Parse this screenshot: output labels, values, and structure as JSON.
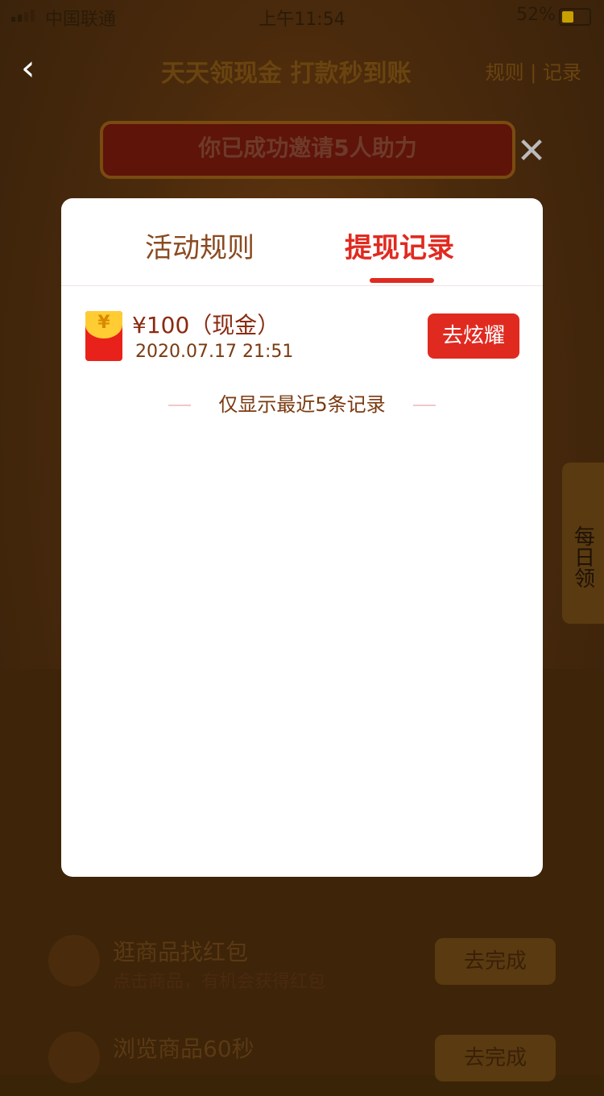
{
  "status_bar": {
    "carrier": "中国联通",
    "time": "上午11:54",
    "battery": "52%"
  },
  "nav": {
    "title": "天天领现金 打款秒到账",
    "right_links": "规则 | 记录"
  },
  "invite_banner": "你已成功邀请5人助力",
  "side_daily": "每日领",
  "dialog": {
    "tabs": [
      "活动规则",
      "提现记录"
    ],
    "active_tab": "提现记录",
    "record": {
      "amount": "¥100（现金）",
      "date": "2020.07.17  21:51",
      "button": "去炫耀"
    },
    "note": "仅显示最近5条记录"
  },
  "background_tasks": [
    {
      "title": "逛商品找红包",
      "desc": "点击商品，有机会获得红包",
      "button": "去完成"
    },
    {
      "title": "浏览商品60秒",
      "desc": "",
      "button": "去完成"
    }
  ],
  "colors": {
    "accent": "#e02a20",
    "overlay": "#3a2408"
  }
}
